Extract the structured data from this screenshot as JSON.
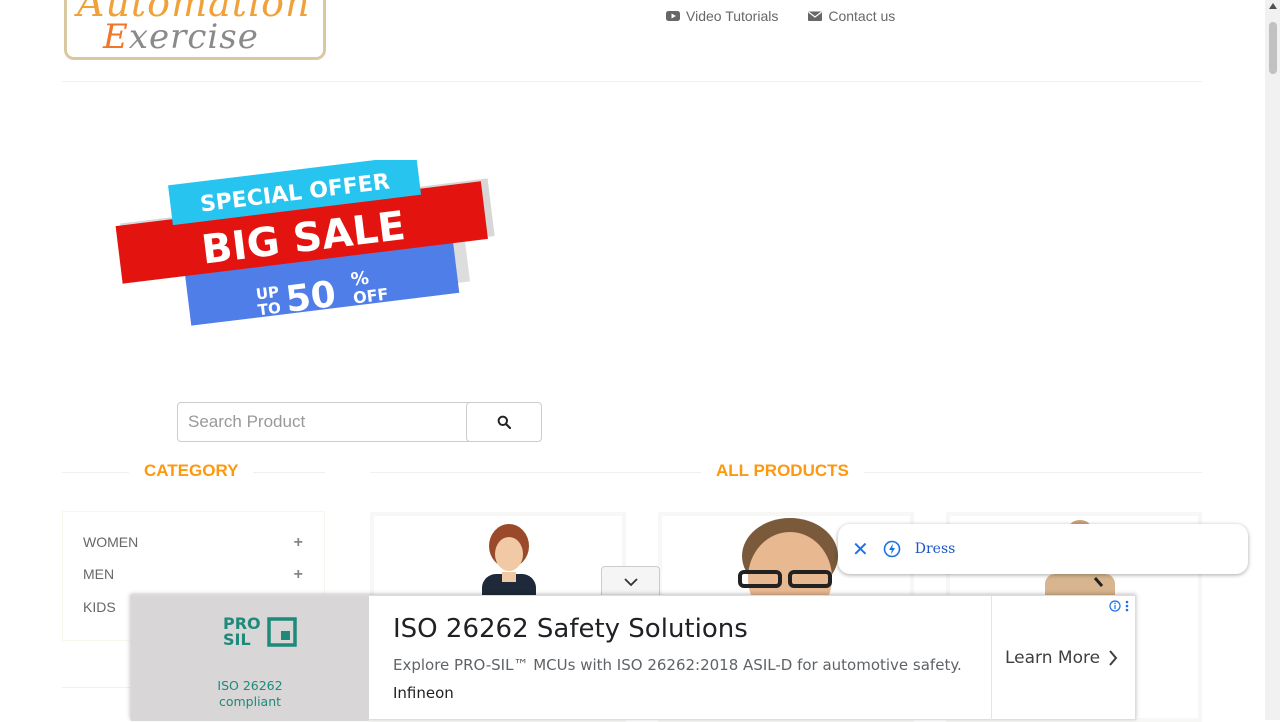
{
  "header": {
    "logo_line1": "Automation",
    "logo_line2_first": "E",
    "logo_line2_rest": "xercise",
    "nav": [
      {
        "label": "Video Tutorials",
        "icon": "youtube-icon"
      },
      {
        "label": "Contact us",
        "icon": "envelope-icon"
      }
    ]
  },
  "banner": {
    "line1": "SPECIAL OFFER",
    "line2": "BIG SALE",
    "line3_up": "UP",
    "line3_to": "TO",
    "line3_num": "50",
    "line3_pct": "%",
    "line3_off": "OFF"
  },
  "search": {
    "placeholder": "Search Product",
    "value": ""
  },
  "category": {
    "title": "CATEGORY",
    "items": [
      {
        "label": "WOMEN"
      },
      {
        "label": "MEN"
      },
      {
        "label": "KIDS"
      }
    ]
  },
  "products": {
    "title": "ALL PRODUCTS"
  },
  "suggestion_chip": {
    "label": "Dress"
  },
  "ad": {
    "logo_top": "PRO",
    "logo_bottom": "SIL",
    "badge_line1": "ISO 26262",
    "badge_line2": "compliant",
    "title": "ISO 26262 Safety Solutions",
    "description": "Explore PRO-SIL™ MCUs with ISO 26262:2018 ASIL-D for automotive safety.",
    "advertiser": "Infineon",
    "cta": "Learn More"
  },
  "colors": {
    "accent": "#FE980F",
    "link_blue": "#1a73e8",
    "ad_teal": "#1d8a7a"
  }
}
